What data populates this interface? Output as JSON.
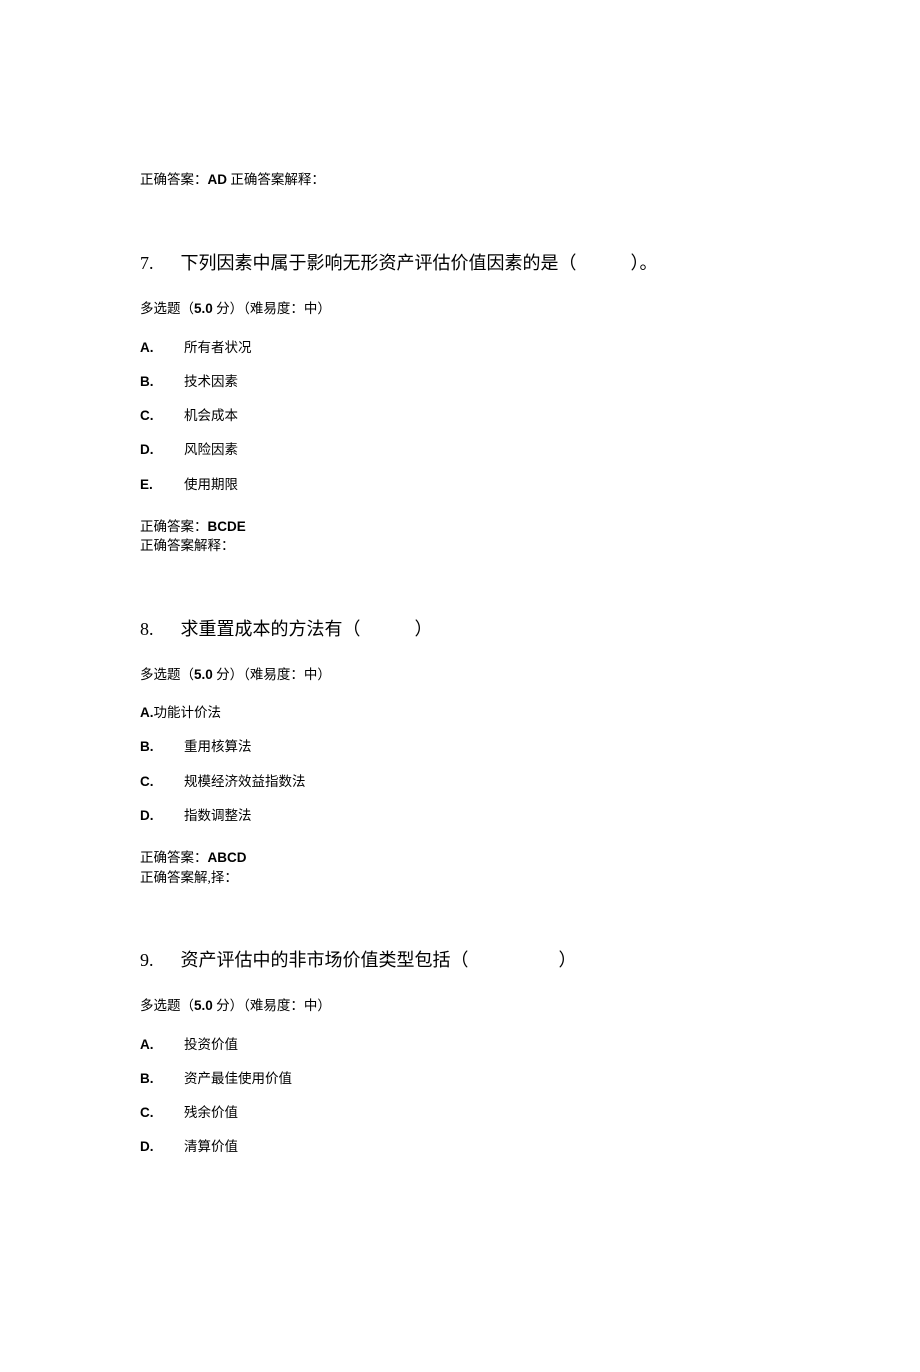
{
  "prev_answer": {
    "label": "正确答案：",
    "value": "AD",
    "explain_label": " 正确答案解释："
  },
  "q7": {
    "number": "7.",
    "title_before": "下列因素中属于影响无形资产评估价值因素的是（",
    "title_after": "）。",
    "meta_before": "多选题（",
    "meta_points": "5.0",
    "meta_after": " 分）（难易度：中）",
    "options": [
      {
        "letter": "A.",
        "text": "所有者状况"
      },
      {
        "letter": "B.",
        "text": "技术因素"
      },
      {
        "letter": "C.",
        "text": "机会成本"
      },
      {
        "letter": "D.",
        "text": "风险因素"
      },
      {
        "letter": "E.",
        "text": "使用期限"
      }
    ],
    "answer_label": "正确答案：",
    "answer_value": "BCDE",
    "explain_label": "正确答案解释："
  },
  "q8": {
    "number": "8.",
    "title_before": "求重置成本的方法有（",
    "title_after": "）",
    "meta_before": "多选题（",
    "meta_points": "5.0",
    "meta_after": " 分）（难易度：中）",
    "option_a_letter": "A.",
    "option_a_text": "功能计价法",
    "options_rest": [
      {
        "letter": "B.",
        "text": "重用核算法"
      },
      {
        "letter": "C.",
        "text": "规模经济效益指数法"
      },
      {
        "letter": "D.",
        "text": "指数调整法"
      }
    ],
    "answer_label": "正确答案：",
    "answer_value": "ABCD",
    "explain_label": "正确答案解,择："
  },
  "q9": {
    "number": "9.",
    "title_before": "资产评估中的非市场价值类型包括（",
    "title_after": "）",
    "meta_before": "多选题（",
    "meta_points": "5.0",
    "meta_after": " 分）（难易度：中）",
    "options": [
      {
        "letter": "A.",
        "text": "投资价值"
      },
      {
        "letter": "B.",
        "text": "资产最佳使用价值"
      },
      {
        "letter": "C.",
        "text": "残余价值"
      },
      {
        "letter": "D.",
        "text": "清算价值"
      }
    ]
  }
}
